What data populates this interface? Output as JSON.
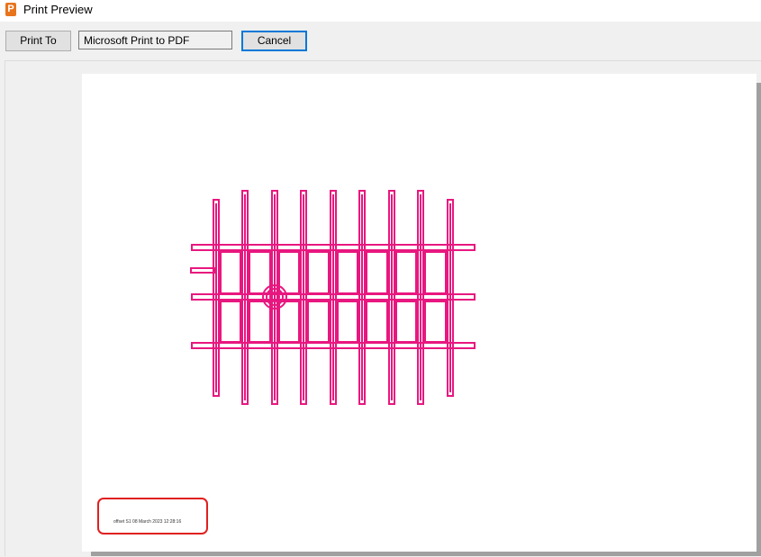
{
  "window": {
    "title": "Print Preview",
    "icon": "app-icon"
  },
  "toolbar": {
    "print_to_label": "Print To",
    "printer_name": "Microsoft Print to PDF",
    "cancel_label": "Cancel"
  },
  "preview": {
    "footer_text": "offset S1 08 March 2023 12:28:16",
    "drawing_color": "#e8177f"
  }
}
